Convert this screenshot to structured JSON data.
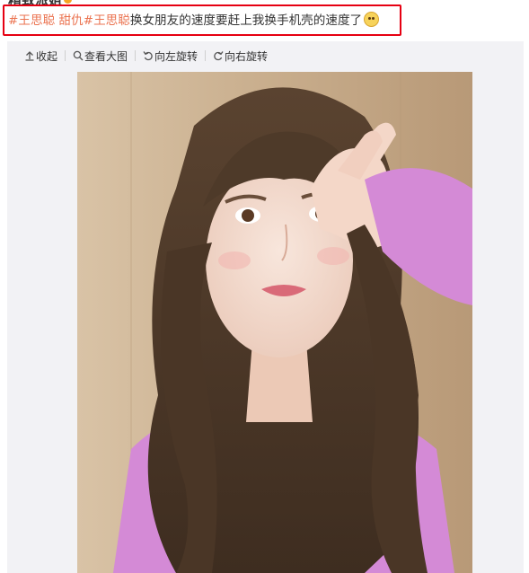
{
  "post": {
    "author": "精致派姐",
    "text_segments": {
      "hashtag_1": "#王思聪 甜仇#",
      "hashtag_2": "王思聪",
      "body": "换女朋友的速度要赶上我换手机壳的速度了"
    },
    "emoji": "smiling-face-emoji",
    "highlight_color": "#e60012"
  },
  "toolbar": {
    "collapse_label": "收起",
    "view_large_label": "查看大图",
    "rotate_left_label": "向左旋转",
    "rotate_right_label": "向右旋转"
  },
  "colors": {
    "hashtag": "#eb7350",
    "text": "#333333",
    "panel_bg": "#f2f2f5"
  }
}
